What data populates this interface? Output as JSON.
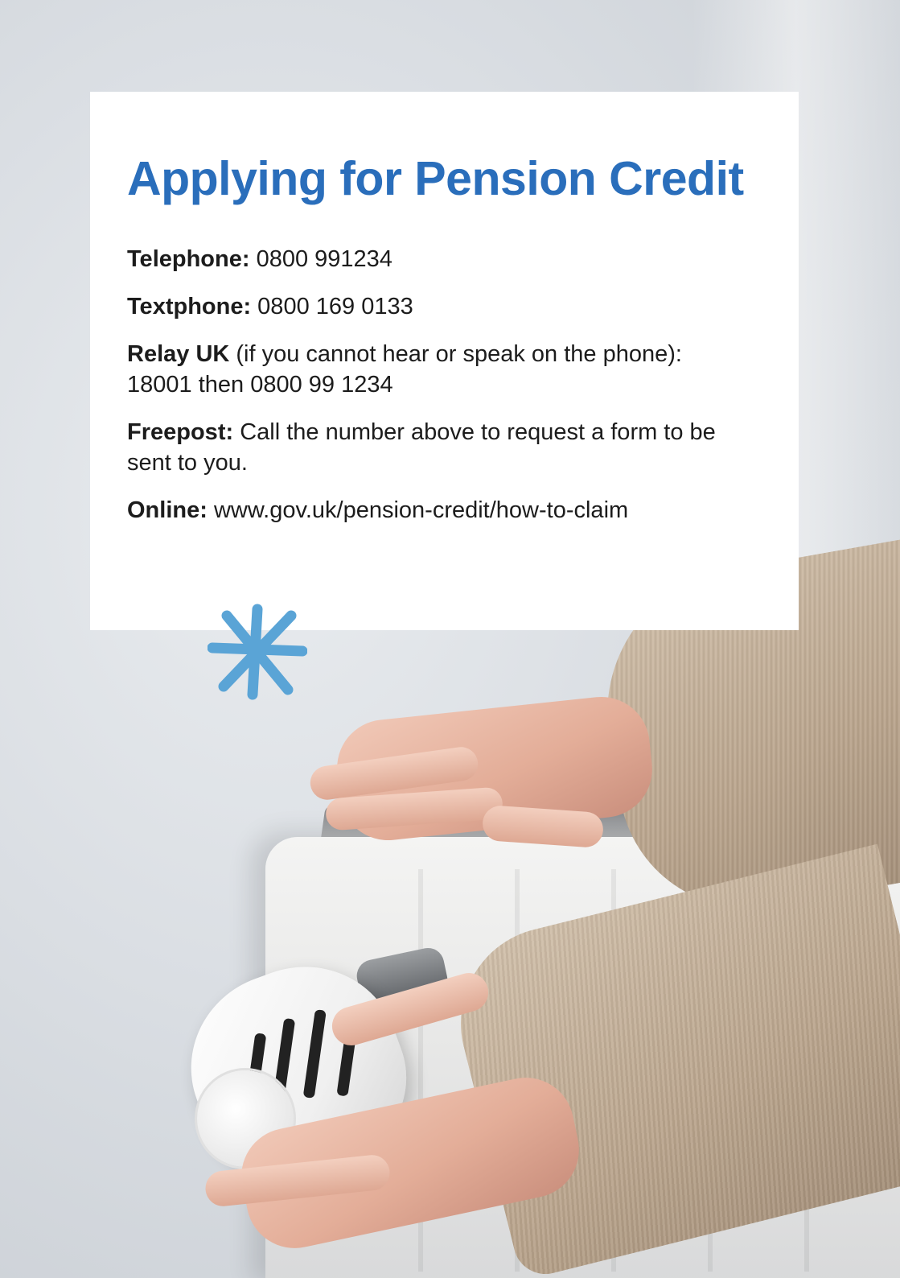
{
  "card": {
    "title": "Applying for Pension Credit",
    "rows": [
      {
        "label": "Telephone:",
        "text": " 0800 991234"
      },
      {
        "label": "Textphone:",
        "text": " 0800 169 0133"
      },
      {
        "label": "Relay UK",
        "text": " (if you cannot hear or speak on the phone): 18001 then 0800 99 1234"
      },
      {
        "label": "Freepost:",
        "text": " Call the number above to request a form to be sent to you."
      },
      {
        "label": "Online:",
        "text": " www.gov.uk/pension-credit/how-to-claim"
      }
    ]
  },
  "colors": {
    "title": "#2a6ebb",
    "asterisk": "#5aa4d6",
    "card_background": "#ffffff",
    "body_text": "#1c1c1c"
  },
  "icons": {
    "decoration": "asterisk-icon"
  }
}
